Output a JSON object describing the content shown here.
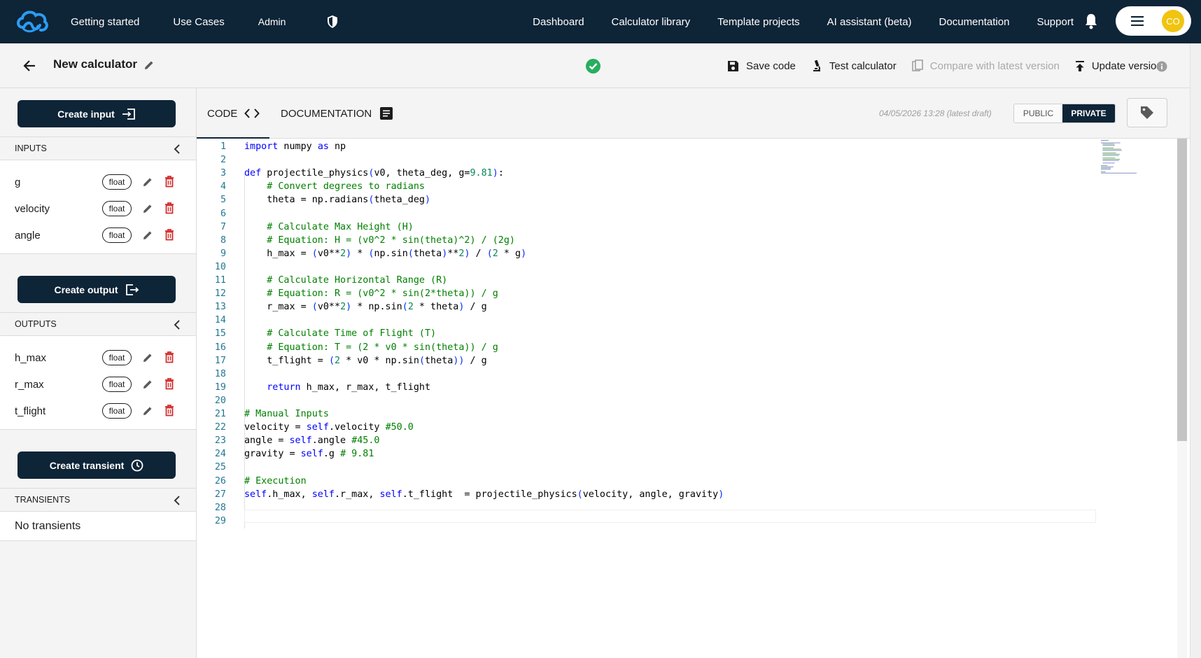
{
  "nav": {
    "links_left": [
      "Getting started",
      "Use Cases"
    ],
    "admin_label": "Admin",
    "links_right": [
      "Dashboard",
      "Calculator library",
      "Template projects",
      "AI assistant (beta)",
      "Documentation",
      "Support"
    ],
    "avatar_initials": "CO"
  },
  "header": {
    "title": "New calculator",
    "save_label": "Save code",
    "test_label": "Test calculator",
    "compare_label": "Compare with latest version",
    "update_label": "Update version"
  },
  "sidebar": {
    "create_input": "Create input",
    "inputs_header": "INPUTS",
    "inputs": [
      {
        "name": "g",
        "type": "float"
      },
      {
        "name": "velocity",
        "type": "float"
      },
      {
        "name": "angle",
        "type": "float"
      }
    ],
    "create_output": "Create output",
    "outputs_header": "OUTPUTS",
    "outputs": [
      {
        "name": "h_max",
        "type": "float"
      },
      {
        "name": "r_max",
        "type": "float"
      },
      {
        "name": "t_flight",
        "type": "float"
      }
    ],
    "create_transient": "Create transient",
    "transients_header": "TRANSIENTS",
    "no_transients": "No transients"
  },
  "editor": {
    "tab_code": "CODE",
    "tab_doc": "DOCUMENTATION",
    "timestamp": "04/05/2026 13:28 (latest draft)",
    "visibility_public": "PUBLIC",
    "visibility_private": "PRIVATE",
    "lines": [
      "import numpy as np",
      "",
      "def projectile_physics(v0, theta_deg, g=9.81):",
      "    # Convert degrees to radians",
      "    theta = np.radians(theta_deg)",
      "",
      "    # Calculate Max Height (H)",
      "    # Equation: H = (v0^2 * sin(theta)^2) / (2g)",
      "    h_max = (v0**2) * (np.sin(theta)**2) / (2 * g)",
      "",
      "    # Calculate Horizontal Range (R)",
      "    # Equation: R = (v0^2 * sin(2*theta)) / g",
      "    r_max = (v0**2) * np.sin(2 * theta) / g",
      "",
      "    # Calculate Time of Flight (T)",
      "    # Equation: T = (2 * v0 * sin(theta)) / g",
      "    t_flight = (2 * v0 * np.sin(theta)) / g",
      "",
      "    return h_max, r_max, t_flight",
      "",
      "# Manual Inputs",
      "velocity = self.velocity #50.0",
      "angle = self.angle #45.0",
      "gravity = self.g # 9.81",
      "",
      "# Execution",
      "self.h_max, self.r_max, self.t_flight  = projectile_physics(velocity, angle, gravity)",
      "",
      ""
    ]
  },
  "colors": {
    "navy": "#0e2437",
    "success": "#27ae60",
    "delete": "#d32f2f",
    "avatar": "#f1c40f"
  }
}
